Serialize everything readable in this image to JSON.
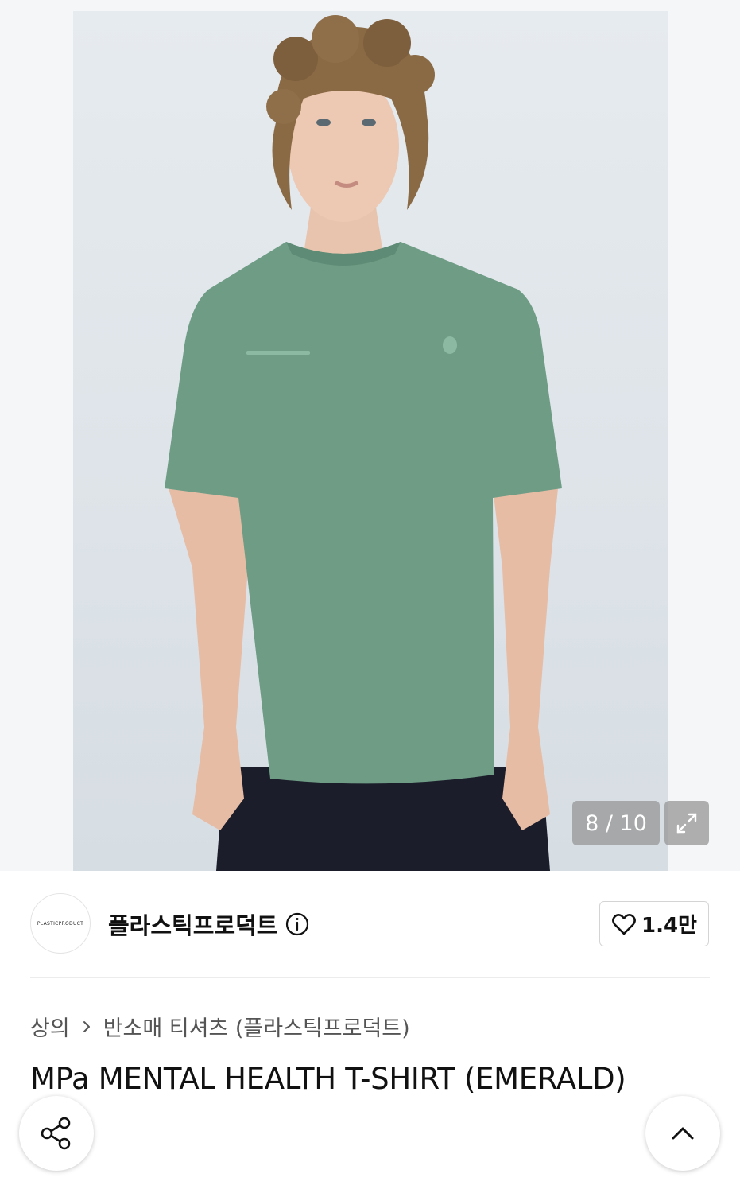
{
  "gallery": {
    "image_alt": "MPa MENTAL HEALTH T-SHIRT (EMERALD)",
    "counter": "8 / 10",
    "current_index": 8,
    "total": 10
  },
  "brand": {
    "logo_text": "PLASTICPRODUCT",
    "name": "플라스틱프로덕트",
    "likes": "1.4만"
  },
  "breadcrumb": {
    "items": [
      "상의",
      "반소매 티셔츠 (플라스틱프로덕트)"
    ]
  },
  "product": {
    "title": "MPa MENTAL HEALTH T-SHIRT (EMERALD)"
  },
  "colors": {
    "shirt": "#6e9c85",
    "background": "#e3e8ec",
    "counter_bg": "#969696"
  },
  "icons": [
    "expand-icon",
    "info-icon",
    "heart-icon",
    "chevron-right-icon",
    "share-icon",
    "chevron-up-icon"
  ]
}
